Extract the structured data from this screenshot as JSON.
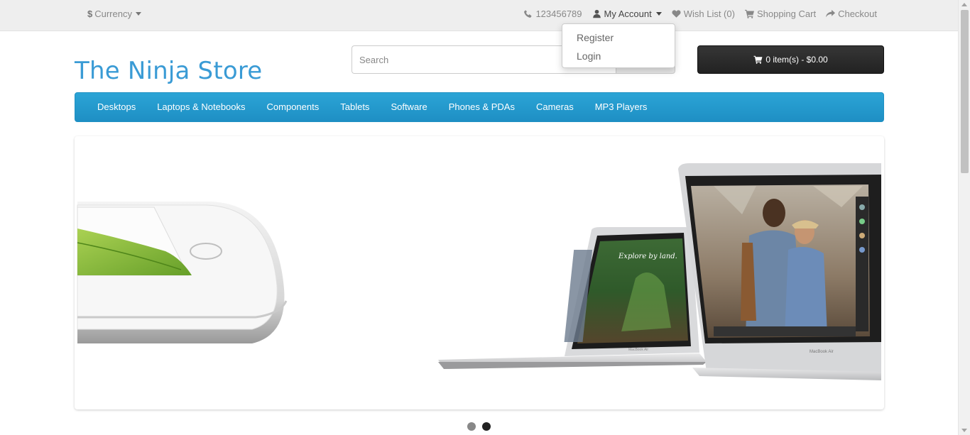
{
  "topbar": {
    "currency_symbol": "$",
    "currency_label": "Currency",
    "phone": "123456789",
    "my_account": "My Account",
    "wish_list": "Wish List (0)",
    "shopping_cart": "Shopping Cart",
    "checkout": "Checkout"
  },
  "account_dropdown": {
    "items": [
      {
        "label": "Register"
      },
      {
        "label": "Login"
      }
    ]
  },
  "header": {
    "logo": "The Ninja Store",
    "search_placeholder": "Search",
    "cart_summary": "0 item(s) - $0.00"
  },
  "nav": {
    "items": [
      {
        "label": "Desktops"
      },
      {
        "label": "Laptops & Notebooks"
      },
      {
        "label": "Components"
      },
      {
        "label": "Tablets"
      },
      {
        "label": "Software"
      },
      {
        "label": "Phones & PDAs"
      },
      {
        "label": "Cameras"
      },
      {
        "label": "MP3 Players"
      }
    ]
  },
  "slider": {
    "screen_caption": "Explore by land.",
    "laptop_label": "MacBook Air",
    "active_slide": 2,
    "slide_count": 2
  },
  "colors": {
    "brand": "#3a9bd5",
    "nav_bg": "#2196cf",
    "cart_bg": "#2b2b2b"
  }
}
